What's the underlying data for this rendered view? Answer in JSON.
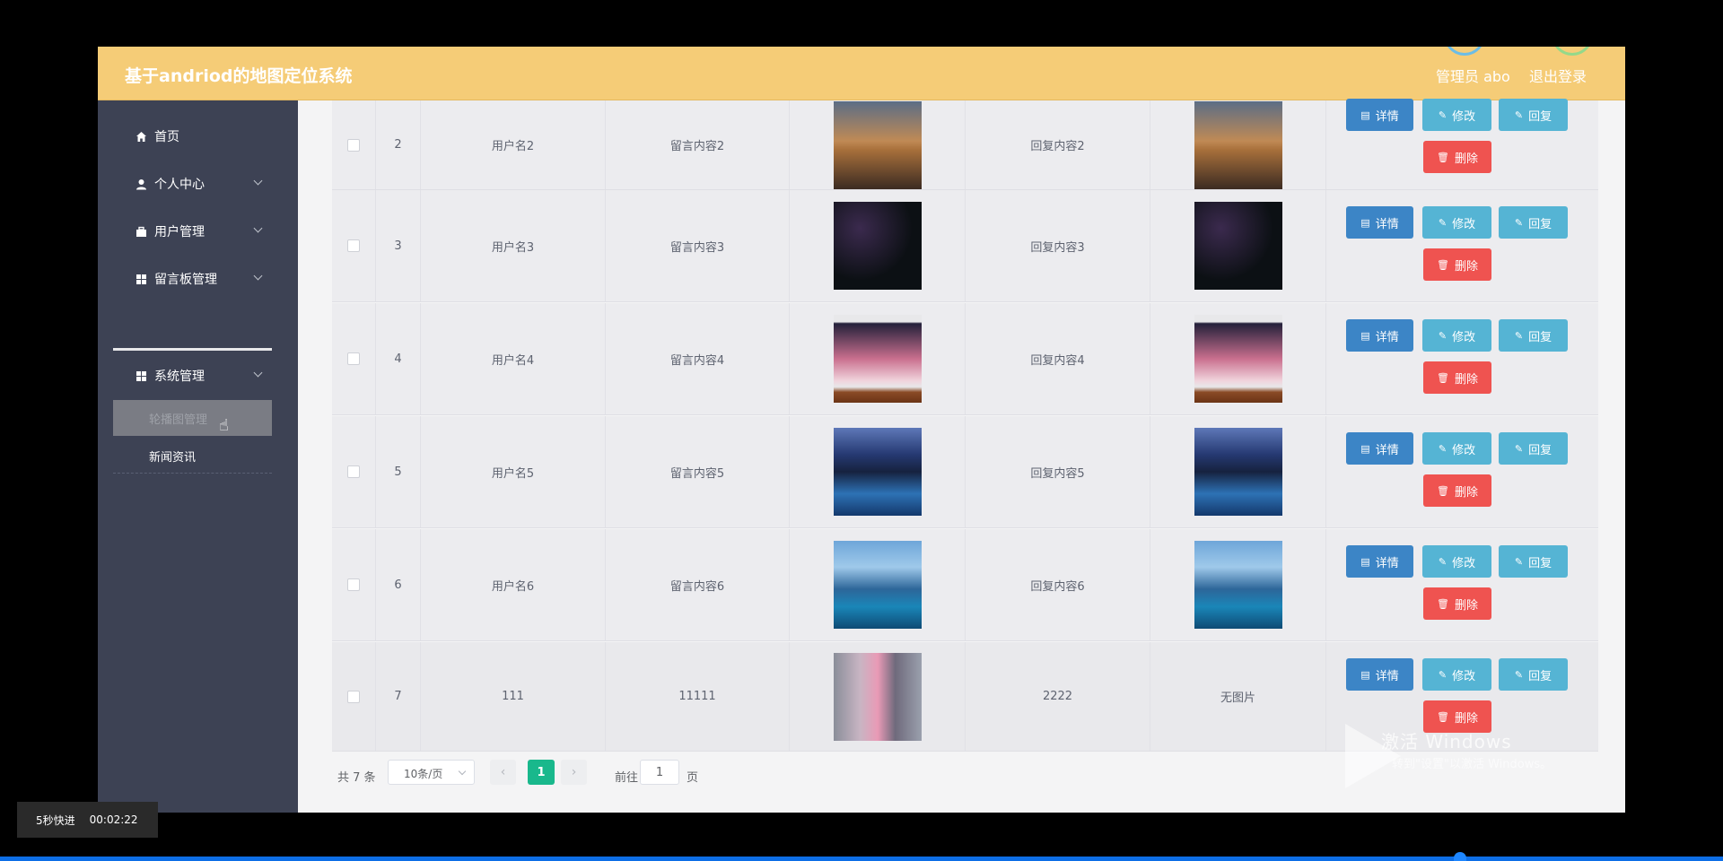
{
  "header": {
    "title": "基于andriod的地图定位系统",
    "user_label": "管理员 abo",
    "logout_label": "退出登录"
  },
  "sidebar": {
    "items": [
      {
        "label": "首页",
        "icon": "home-icon"
      },
      {
        "label": "个人中心",
        "icon": "user-icon"
      },
      {
        "label": "用户管理",
        "icon": "briefcase-icon"
      },
      {
        "label": "留言板管理",
        "icon": "grid-icon"
      },
      {
        "label": "系统管理",
        "icon": "grid-icon"
      }
    ],
    "submenu": [
      {
        "label": "轮播图管理"
      },
      {
        "label": "新闻资讯"
      }
    ]
  },
  "table": {
    "rows": [
      {
        "index": "2",
        "username": "用户名2",
        "message": "留言内容2",
        "reply": "回复内容2",
        "reply_image": "image",
        "image_theme": "sunset"
      },
      {
        "index": "3",
        "username": "用户名3",
        "message": "留言内容3",
        "reply": "回复内容3",
        "reply_image": "image",
        "image_theme": "flowers"
      },
      {
        "index": "4",
        "username": "用户名4",
        "message": "留言内容4",
        "reply": "回复内容4",
        "reply_image": "image",
        "image_theme": "painting"
      },
      {
        "index": "5",
        "username": "用户名5",
        "message": "留言内容5",
        "reply": "回复内容5",
        "reply_image": "image",
        "image_theme": "lake"
      },
      {
        "index": "6",
        "username": "用户名6",
        "message": "留言内容6",
        "reply": "回复内容6",
        "reply_image": "image",
        "image_theme": "sky"
      },
      {
        "index": "7",
        "username": "111",
        "message": "11111",
        "reply": "2222",
        "reply_image": "无图片",
        "image_theme": "trees"
      }
    ],
    "actions": {
      "detail": "详情",
      "edit": "修改",
      "reply": "回复",
      "delete": "删除"
    }
  },
  "pagination": {
    "total": "共 7 条",
    "page_size": "10条/页",
    "prev": "‹",
    "next": "›",
    "current": "1",
    "goto_label": "前往",
    "goto_value": "1",
    "page_suffix": "页"
  },
  "watermark": {
    "line1": "激活 Windows",
    "line2": "转到\"设置\"以激活 Windows。"
  },
  "video": {
    "skip_label": "5秒快进",
    "time": "00:02:22"
  },
  "colors": {
    "header_bg": "#f5cc77",
    "sidebar_bg": "#3d4254",
    "detail_btn": "#3c85c6",
    "edit_btn": "#55b4d4",
    "delete_btn": "#ef5350",
    "page_active": "#19b88c"
  }
}
